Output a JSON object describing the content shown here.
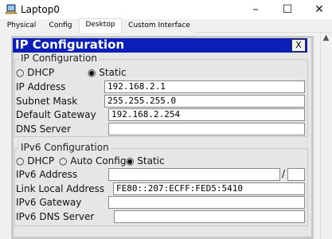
{
  "window": {
    "title": "Laptop0",
    "minimize": "–",
    "maximize": "☐",
    "close": "✕"
  },
  "tabs": [
    {
      "label": "Physical"
    },
    {
      "label": "Config"
    },
    {
      "label": "Desktop"
    },
    {
      "label": "Custom Interface"
    }
  ],
  "active_tab": "Desktop",
  "dialog": {
    "title": "IP Configuration",
    "close": "X",
    "ipv4": {
      "group_title": "IP Configuration",
      "dhcp_label": "○ DHCP",
      "static_label": "◉ Static",
      "mode": "Static",
      "ip_label": "IP Address",
      "ip_value": "192.168.2.1",
      "mask_label": "Subnet Mask",
      "mask_value": "255.255.255.0",
      "gateway_label": "Default Gateway",
      "gateway_value": "192.168.2.254",
      "dns_label": "DNS Server",
      "dns_value": ""
    },
    "ipv6": {
      "group_title": "IPv6 Configuration",
      "dhcp_label": "○ DHCP",
      "auto_label": "○ Auto Config",
      "static_label": "◉ Static",
      "mode": "Static",
      "address_label": "IPv6 Address",
      "address_value": "",
      "prefix_sep": "/",
      "prefix_value": "",
      "link_local_label": "Link Local Address",
      "link_local_value": "FE80::207:ECFF:FED5:5410",
      "gateway_label": "IPv6 Gateway",
      "gateway_value": "",
      "dns_label": "IPv6 DNS Server",
      "dns_value": ""
    }
  },
  "edge_text": "t"
}
